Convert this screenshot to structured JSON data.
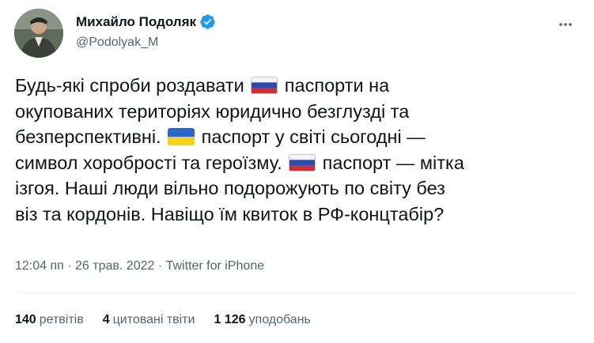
{
  "author": {
    "name": "Михайло Подоляк",
    "handle": "@Podolyak_M",
    "verified": true
  },
  "tweet": {
    "lines": [
      [
        {
          "t": "text",
          "v": "Будь-які спроби роздавати "
        },
        {
          "t": "flag",
          "v": "ru"
        },
        {
          "t": "text",
          "v": " паспорти на"
        }
      ],
      [
        {
          "t": "text",
          "v": "окупованих територіях юридично безглузді та"
        }
      ],
      [
        {
          "t": "text",
          "v": "безперспективні. "
        },
        {
          "t": "flag",
          "v": "ua"
        },
        {
          "t": "text",
          "v": " паспорт у світі сьогодні —"
        }
      ],
      [
        {
          "t": "text",
          "v": "символ хоробрості та героїзму. "
        },
        {
          "t": "flag",
          "v": "ru"
        },
        {
          "t": "text",
          "v": " паспорт — мітка"
        }
      ],
      [
        {
          "t": "text",
          "v": "ізгоя. Наші люди вільно подорожують по світу без"
        }
      ],
      [
        {
          "t": "text",
          "v": "віз та кордонів. Навіщо їм квиток в РФ-концтабір?"
        }
      ]
    ]
  },
  "meta": {
    "time": "12:04 пп",
    "separator": " · ",
    "date": "26 трав. 2022",
    "source": "Twitter for iPhone"
  },
  "stats": {
    "retweets": {
      "count": "140",
      "label": "ретвітів"
    },
    "quotes": {
      "count": "4",
      "label": "цитовані твіти"
    },
    "likes": {
      "count": "1 126",
      "label": "уподобань"
    }
  },
  "colors": {
    "verified": "#1d9bf0",
    "text": "#0f1419",
    "secondary": "#536471"
  }
}
